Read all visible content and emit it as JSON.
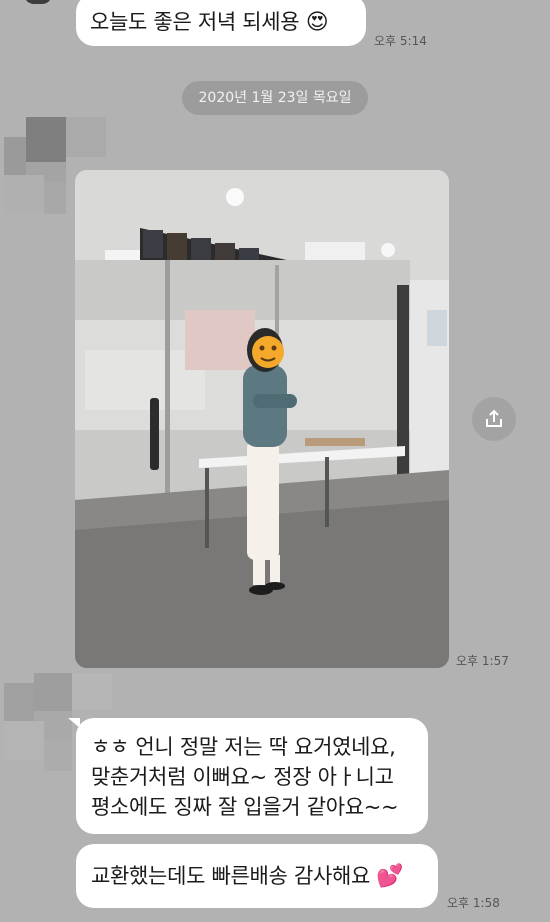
{
  "messages": {
    "m1": {
      "text": "오늘도 좋은 저녁 되세용",
      "emoji": "😍",
      "time": "오후 5:14"
    },
    "date_divider": "2020년 1월 23일 목요일",
    "photo": {
      "time": "오후 1:57"
    },
    "m2": {
      "lines": [
        "ㅎㅎ 언니 정말 저는 딱 요거였네요,",
        "맞춘거처럼 이뻐요~ 정장 아ㅏ니고",
        "평소에도 징짜 잘 입을거 같아요~~"
      ]
    },
    "m3": {
      "text": "교환했는데도 빠른배송 감사해요",
      "emoji": "💕",
      "time": "오후 1:58"
    }
  },
  "icons": {
    "share": "share-icon",
    "avatar": "pixelated-avatar"
  },
  "colors": {
    "background": "#b2b2b2",
    "bubble": "#ffffff",
    "date_pill": "#9c9c9c"
  }
}
